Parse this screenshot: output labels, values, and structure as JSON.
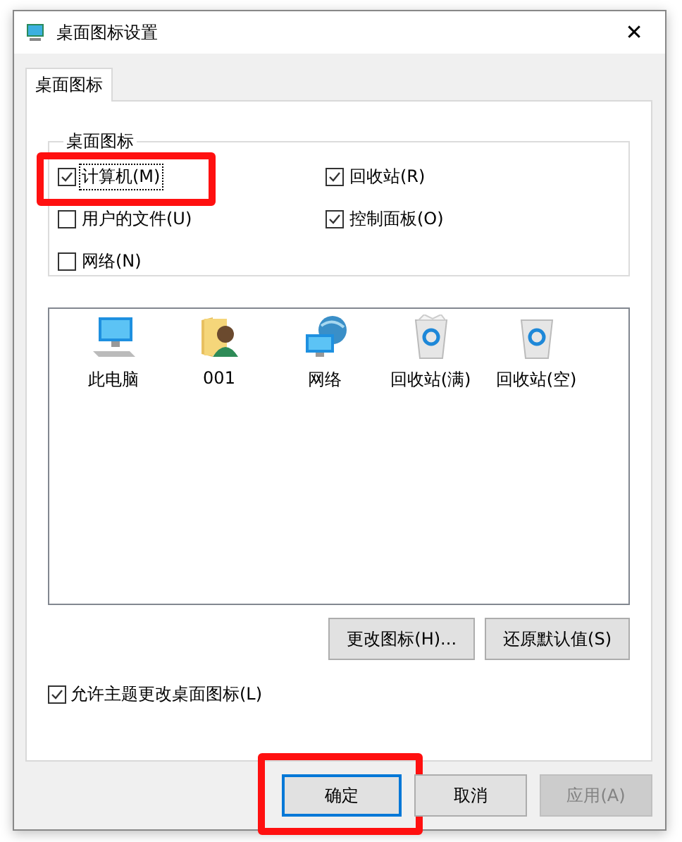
{
  "window": {
    "title": "桌面图标设置",
    "close": "✕"
  },
  "tabs": [
    {
      "label": "桌面图标",
      "selected": true
    }
  ],
  "group": {
    "title": "桌面图标",
    "checkboxes": [
      {
        "label": "计算机(M)",
        "checked": true,
        "highlighted": true,
        "focused": true
      },
      {
        "label": "回收站(R)",
        "checked": true,
        "highlighted": false,
        "focused": false
      },
      {
        "label": "用户的文件(U)",
        "checked": false,
        "highlighted": false,
        "focused": false
      },
      {
        "label": "控制面板(O)",
        "checked": true,
        "highlighted": false,
        "focused": false
      },
      {
        "label": "网络(N)",
        "checked": false,
        "highlighted": false,
        "focused": false
      }
    ]
  },
  "icons": [
    {
      "kind": "computer",
      "label": "此电脑"
    },
    {
      "kind": "user",
      "label": "001"
    },
    {
      "kind": "network",
      "label": "网络"
    },
    {
      "kind": "bin-full",
      "label": "回收站(满)"
    },
    {
      "kind": "bin-empty",
      "label": "回收站(空)"
    }
  ],
  "icon_buttons": [
    "更改图标(H)...",
    "还原默认值(S)"
  ],
  "allow_themes": {
    "label": "允许主题更改桌面图标(L)",
    "checked": true
  },
  "buttons": [
    {
      "label": "确定",
      "default": true,
      "disabled": false,
      "highlighted": true
    },
    {
      "label": "取消",
      "default": false,
      "disabled": false,
      "highlighted": false
    },
    {
      "label": "应用(A)",
      "default": false,
      "disabled": true,
      "highlighted": false
    }
  ]
}
